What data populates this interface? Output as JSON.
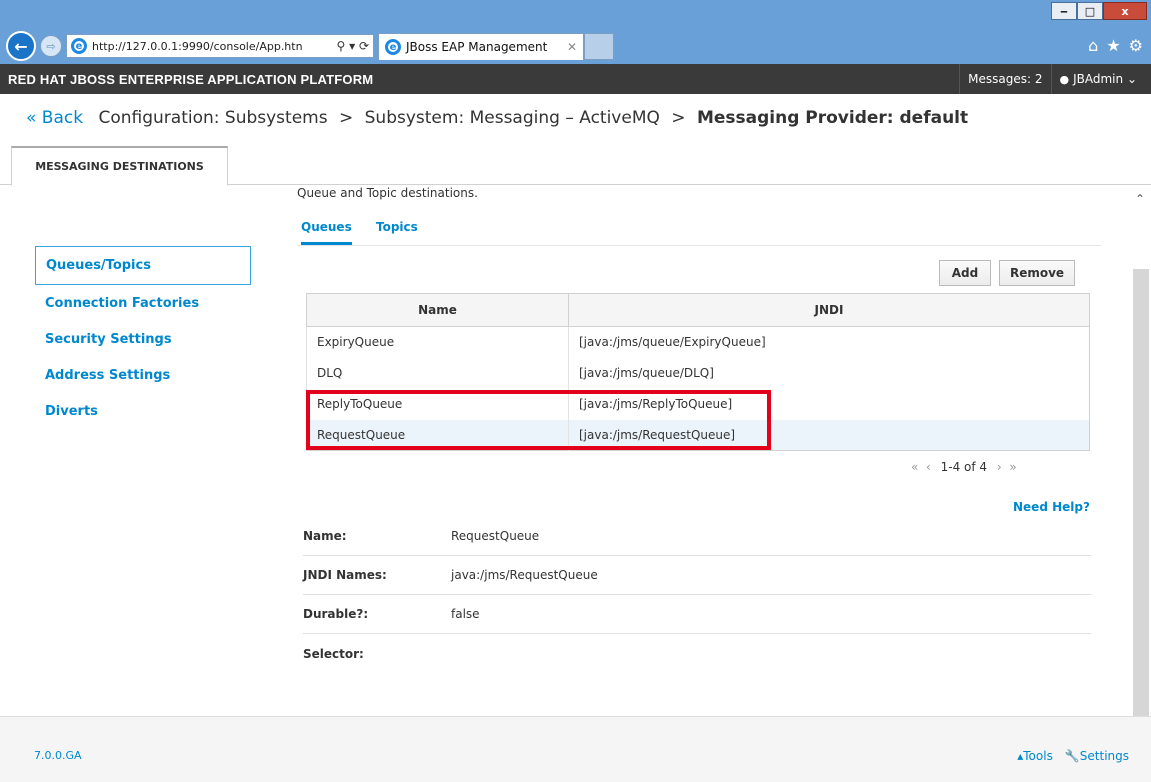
{
  "browser": {
    "url": "http://127.0.0.1:9990/console/App.htn",
    "tab_title": "JBoss EAP Management",
    "win_minimize": "‒",
    "win_maximize": "□",
    "win_close": "x"
  },
  "header": {
    "brand": "RED HAT JBOSS ENTERPRISE APPLICATION PLATFORM",
    "messages": "Messages: 2",
    "user": "JBAdmin"
  },
  "breadcrumb": {
    "back": "« Back",
    "items": [
      "Configuration: Subsystems",
      "Subsystem: Messaging – ActiveMQ"
    ],
    "sep": ">",
    "current": "Messaging Provider: default"
  },
  "main_tab": "MESSAGING DESTINATIONS",
  "sidebar": {
    "items": [
      {
        "label": "Queues/Topics"
      },
      {
        "label": "Connection Factories"
      },
      {
        "label": "Security Settings"
      },
      {
        "label": "Address Settings"
      },
      {
        "label": "Diverts"
      }
    ]
  },
  "content": {
    "description": "Queue and Topic destinations.",
    "tabs": [
      {
        "label": "Queues"
      },
      {
        "label": "Topics"
      }
    ],
    "add": "Add",
    "remove": "Remove",
    "columns": [
      "Name",
      "JNDI"
    ],
    "rows": [
      {
        "name": "ExpiryQueue",
        "jndi": "[java:/jms/queue/ExpiryQueue]"
      },
      {
        "name": "DLQ",
        "jndi": "[java:/jms/queue/DLQ]"
      },
      {
        "name": "ReplyToQueue",
        "jndi": "[java:/jms/ReplyToQueue]"
      },
      {
        "name": "RequestQueue",
        "jndi": "[java:/jms/RequestQueue]"
      }
    ],
    "pager": "1-4 of 4",
    "need_help": "Need Help?",
    "details": [
      {
        "key": "Name:",
        "value": "RequestQueue"
      },
      {
        "key": "JNDI Names:",
        "value": "java:/jms/RequestQueue"
      },
      {
        "key": "Durable?:",
        "value": "false"
      },
      {
        "key": "Selector:",
        "value": ""
      }
    ]
  },
  "footer": {
    "version": "7.0.0.GA",
    "tools": "Tools",
    "settings": "Settings"
  },
  "colors": {
    "accent": "#0088ce",
    "highlight": "#e2001a",
    "appbar": "#3a3a3a"
  }
}
